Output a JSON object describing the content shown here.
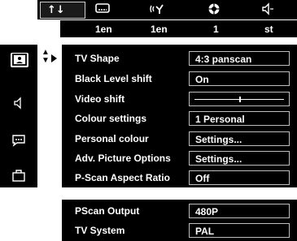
{
  "topbar": {
    "icons": [
      "picture-settings-icon",
      "subtitle-icon",
      "audio-language-icon",
      "angle-icon",
      "audio-icon"
    ],
    "values": [
      "1en",
      "1en",
      "1",
      "st"
    ]
  },
  "sidebar": {
    "items": [
      "tv-picture-icon",
      "speaker-icon",
      "subtitle-chat-icon",
      "briefcase-icon"
    ]
  },
  "settings": [
    {
      "label": "TV Shape",
      "value": "4:3  panscan"
    },
    {
      "label": "Black Level shift",
      "value": "On"
    },
    {
      "label": "Video shift",
      "value": ""
    },
    {
      "label": "Colour settings",
      "value": "1 Personal"
    },
    {
      "label": "Personal colour",
      "value": "Settings..."
    },
    {
      "label": "Adv. Picture Options",
      "value": "Settings..."
    },
    {
      "label": "P-Scan Aspect Ratio",
      "value": "Off"
    }
  ],
  "output": [
    {
      "label": "PScan Output",
      "value": "480P"
    },
    {
      "label": "TV System",
      "value": "PAL"
    }
  ],
  "video_shift_level": 0.5
}
